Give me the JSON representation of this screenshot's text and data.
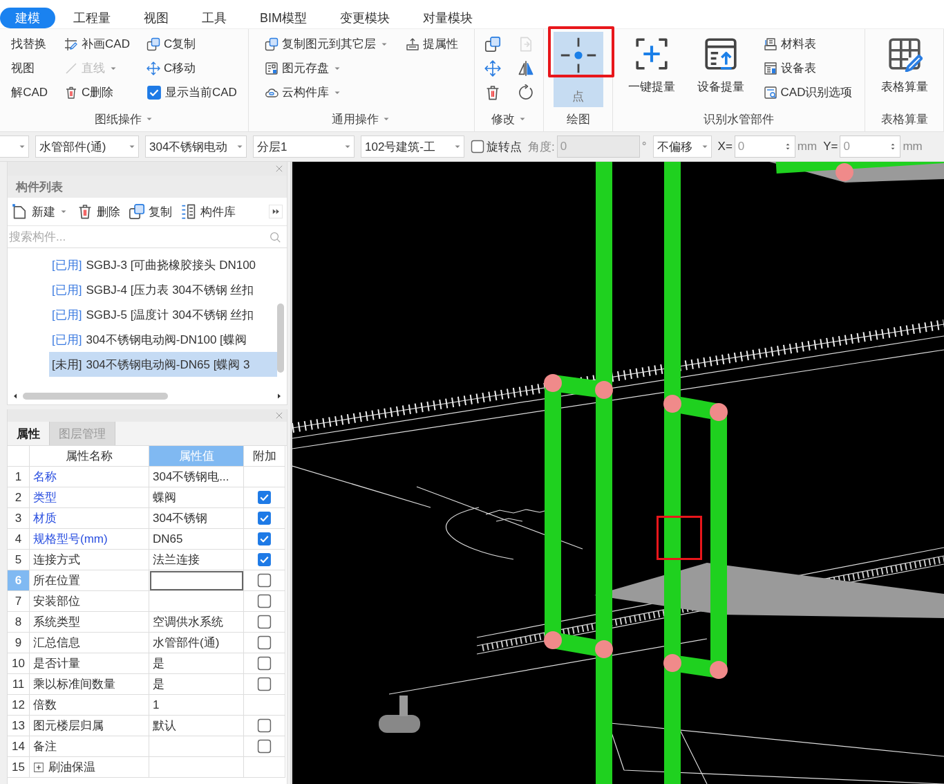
{
  "ribbon_tabs": [
    {
      "label": "建模",
      "selected": true
    },
    {
      "label": "工程量",
      "selected": false
    },
    {
      "label": "视图",
      "selected": false
    },
    {
      "label": "工具",
      "selected": false
    },
    {
      "label": "BIM模型",
      "selected": false
    },
    {
      "label": "变更模块",
      "selected": false
    },
    {
      "label": "对量模块",
      "selected": false
    }
  ],
  "ribbon_groups": [
    {
      "label": "图纸操作",
      "menu": true,
      "items": [
        {
          "kind": "small",
          "label": "找替换"
        },
        {
          "kind": "small",
          "label": "视图"
        },
        {
          "kind": "small",
          "label": "解CAD"
        },
        {
          "kind": "small",
          "label": "补画CAD"
        },
        {
          "kind": "small",
          "label": "直线",
          "disabled": true,
          "dropdown": true
        },
        {
          "kind": "small",
          "label": "C删除"
        },
        {
          "kind": "small",
          "label": "C复制"
        },
        {
          "kind": "small",
          "label": "C移动"
        },
        {
          "kind": "check",
          "label": "显示当前CAD",
          "checked": true
        }
      ]
    },
    {
      "label": "通用操作",
      "menu": true,
      "items": [
        {
          "kind": "small",
          "label": "复制图元到其它层",
          "dropdown": true
        },
        {
          "kind": "small",
          "label": "图元存盘",
          "dropdown": true
        },
        {
          "kind": "small",
          "label": "云构件库",
          "dropdown": true
        },
        {
          "kind": "small",
          "label": "提属性"
        }
      ]
    },
    {
      "label": "修改",
      "menu": true,
      "items": [
        {
          "kind": "icon",
          "disabled": false
        },
        {
          "kind": "icon",
          "disabled": false
        },
        {
          "kind": "icon",
          "disabled": false
        },
        {
          "kind": "icon",
          "disabled": true
        },
        {
          "kind": "icon",
          "disabled": false
        },
        {
          "kind": "icon",
          "disabled": false
        }
      ]
    },
    {
      "label": "绘图",
      "menu": false,
      "items": [
        {
          "kind": "large",
          "label": "点",
          "selected": true,
          "highlighted": true
        }
      ]
    },
    {
      "label": "识别水管部件",
      "menu": false,
      "items": [
        {
          "kind": "large",
          "label": "一键提量",
          "selected": false
        },
        {
          "kind": "large",
          "label": "设备提量",
          "selected": false
        },
        {
          "kind": "small",
          "label": "材料表"
        },
        {
          "kind": "small",
          "label": "设备表"
        },
        {
          "kind": "small",
          "label": "CAD识别选项"
        }
      ]
    },
    {
      "label": "表格算量",
      "menu": false,
      "items": [
        {
          "kind": "large",
          "label": "表格算量",
          "selected": false
        }
      ]
    }
  ],
  "toolbar": [
    {
      "kind": "dropdown"
    },
    {
      "kind": "dropdown",
      "value": "水管部件(通)"
    },
    {
      "kind": "dropdown",
      "value": "304不锈钢电动"
    },
    {
      "kind": "dropdown",
      "value": "分层1"
    },
    {
      "kind": "dropdown",
      "value": "102号建筑-工"
    },
    {
      "kind": "checkbox",
      "label": "旋转点",
      "checked": false
    },
    {
      "kind": "field",
      "label": "角度:",
      "value": "0",
      "unit": "°",
      "disabled": true
    },
    {
      "kind": "dropdown",
      "value": "不偏移"
    },
    {
      "kind": "spinner",
      "label": "X=",
      "value": "0",
      "unit": "mm"
    },
    {
      "kind": "spinner",
      "label": "Y=",
      "value": "0",
      "unit": "mm"
    }
  ],
  "component_list": {
    "title": "构件列表",
    "actions": [
      {
        "label": "新建",
        "dropdown": true
      },
      {
        "label": "删除",
        "dropdown": false
      },
      {
        "label": "复制",
        "dropdown": false
      },
      {
        "label": "构件库",
        "dropdown": false
      }
    ],
    "search": {
      "placeholder": "搜索构件..."
    },
    "items": [
      {
        "tag": "[已用]",
        "used": true,
        "text": "SGBJ-3 [可曲挠橡胶接头 DN100",
        "selected": false
      },
      {
        "tag": "[已用]",
        "used": true,
        "text": "SGBJ-4 [压力表 304不锈钢 丝扣",
        "selected": false
      },
      {
        "tag": "[已用]",
        "used": true,
        "text": "SGBJ-5 [温度计 304不锈钢 丝扣",
        "selected": false
      },
      {
        "tag": "[已用]",
        "used": true,
        "text": "304不锈钢电动阀-DN100 [蝶阀",
        "selected": false
      },
      {
        "tag": "[未用]",
        "used": false,
        "text": "304不锈钢电动阀-DN65 [蝶阀 3",
        "selected": true
      }
    ]
  },
  "properties": {
    "tabs": [
      {
        "label": "属性",
        "selected": true
      },
      {
        "label": "图层管理",
        "selected": false
      }
    ],
    "columns": [
      {
        "label": "属性名称",
        "selected": false
      },
      {
        "label": "属性值",
        "selected": true
      },
      {
        "label": "附加",
        "selected": false
      }
    ],
    "rows": [
      {
        "index": "1",
        "name": "名称",
        "public": true,
        "value": "304不锈钢电...",
        "selected": false
      },
      {
        "index": "2",
        "name": "类型",
        "public": true,
        "value": "蝶阀",
        "checked": true,
        "selected": false
      },
      {
        "index": "3",
        "name": "材质",
        "public": true,
        "value": "304不锈钢",
        "checked": true,
        "selected": false
      },
      {
        "index": "4",
        "name": "规格型号(mm)",
        "public": true,
        "value": "DN65",
        "checked": true,
        "selected": false
      },
      {
        "index": "5",
        "name": "连接方式",
        "public": false,
        "value": "法兰连接",
        "checked": true,
        "selected": false
      },
      {
        "index": "6",
        "name": "所在位置",
        "public": false,
        "checked": false,
        "selected": true
      },
      {
        "index": "7",
        "name": "安装部位",
        "public": false,
        "checked": false,
        "selected": false
      },
      {
        "index": "8",
        "name": "系统类型",
        "public": false,
        "value": "空调供水系统",
        "checked": false,
        "selected": false
      },
      {
        "index": "9",
        "name": "汇总信息",
        "public": false,
        "value": "水管部件(通)",
        "checked": false,
        "selected": false
      },
      {
        "index": "10",
        "name": "是否计量",
        "public": false,
        "value": "是",
        "checked": false,
        "selected": false
      },
      {
        "index": "11",
        "name": "乘以标准间数量",
        "public": false,
        "value": "是",
        "checked": false,
        "selected": false
      },
      {
        "index": "12",
        "name": "倍数",
        "public": false,
        "value": "1",
        "selected": false
      },
      {
        "index": "13",
        "name": "图元楼层归属",
        "public": false,
        "value": "默认",
        "checked": false,
        "selected": false
      },
      {
        "index": "14",
        "name": "备注",
        "public": false,
        "checked": false,
        "selected": false
      },
      {
        "index": "15",
        "name": "刷油保温",
        "public": false,
        "expanded": false,
        "selected": false
      }
    ]
  },
  "viewport": {
    "highlight_box": true
  }
}
